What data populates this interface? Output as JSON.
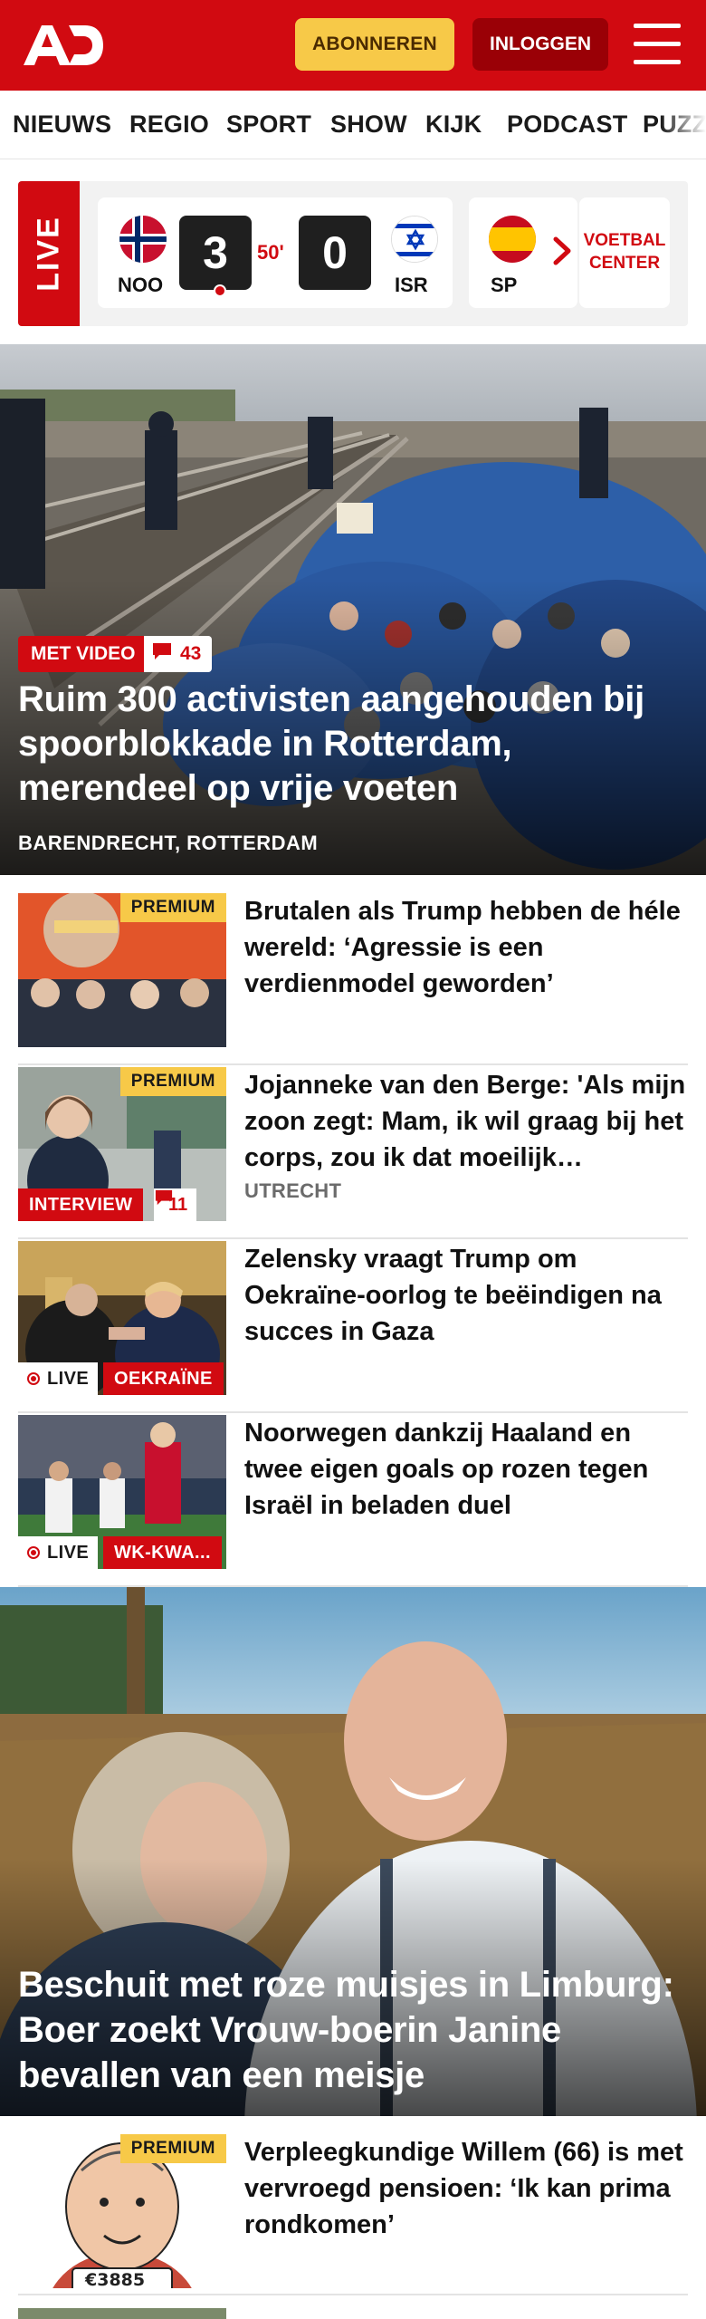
{
  "header": {
    "logo": "AD",
    "subscribe_label": "ABONNEREN",
    "login_label": "INLOGGEN",
    "colors": {
      "brand": "#d10a11",
      "subscribe": "#f7c948",
      "login": "#9a0006"
    }
  },
  "nav": {
    "items": [
      {
        "label": "NIEUWS"
      },
      {
        "label": "REGIO"
      },
      {
        "label": "SPORT"
      },
      {
        "label": "SHOW"
      },
      {
        "label": "KIJK"
      },
      {
        "label": "PODCAST"
      },
      {
        "label": "PUZZ"
      }
    ]
  },
  "live": {
    "tag": "LIVE",
    "match": {
      "home_code": "NOO",
      "home_score": "3",
      "minute": "50'",
      "away_score": "0",
      "away_code": "ISR"
    },
    "next_match": {
      "home_code": "SP"
    },
    "center_label": "VOETBAL CENTER"
  },
  "hero": {
    "badge": "MET VIDEO",
    "comments": "43",
    "title": "Ruim 300 activisten aangehouden bij spoorblokkade in Rotterdam, merendeel op vrije voeten",
    "location": "BARENDRECHT, ROTTERDAM"
  },
  "articles": [
    {
      "premium": "PREMIUM",
      "title": "Brutalen als Trump hebben de héle wereld: ‘Agressie is een verdienmodel geworden’"
    },
    {
      "premium": "PREMIUM",
      "title": "Jojanneke van den Berge: 'Als mijn zoon zegt: Mam, ik wil graag bij het corps, zou ik dat moeilijk…",
      "location": "UTRECHT",
      "tag": "INTERVIEW",
      "comments": "11"
    },
    {
      "title": "Zelensky vraagt Trump om Oekraïne-oorlog te beëindigen na succes in Gaza",
      "live": "LIVE",
      "tag": "OEKRAÏNE"
    },
    {
      "title": "Noorwegen dankzij Haaland en twee eigen goals op rozen tegen Israël in beladen duel",
      "live": "LIVE",
      "tag": "WK-KWA..."
    }
  ],
  "feature": {
    "title": "Beschuit met roze muisjes in Limburg: Boer zoekt Vrouw-boerin Janine bevallen van een meisje"
  },
  "article_after": {
    "premium": "PREMIUM",
    "title": "Verpleegkundige Willem (66) is met vervroegd pensioen: ‘Ik kan prima rondkomen’",
    "sign_text": "€3885"
  }
}
